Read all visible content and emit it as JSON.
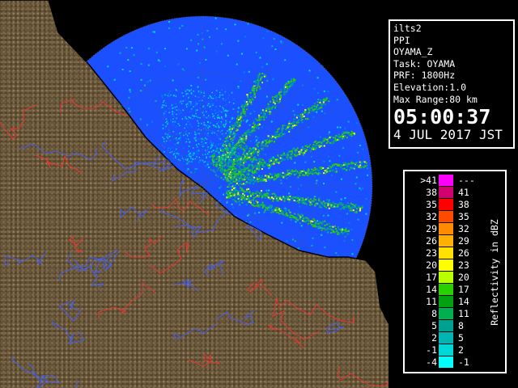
{
  "info": {
    "lines": [
      "ilts2",
      "PPI",
      "OYAMA_Z",
      "Task: OYAMA",
      "PRF: 1800Hz",
      "Elevation:1.0",
      "Max Range:80 km"
    ],
    "time": "05:00:37",
    "date": "4 JUL 2017 JST"
  },
  "legend": {
    "title": "Reflectivity in dBZ",
    "rows": [
      {
        "lo": ">41",
        "hi": "---",
        "color": "#ff00ff"
      },
      {
        "lo": "38",
        "hi": "41",
        "color": "#d0006e"
      },
      {
        "lo": "35",
        "hi": "38",
        "color": "#ff0000"
      },
      {
        "lo": "32",
        "hi": "35",
        "color": "#ff4a00"
      },
      {
        "lo": "29",
        "hi": "32",
        "color": "#ff8c00"
      },
      {
        "lo": "26",
        "hi": "29",
        "color": "#ffb000"
      },
      {
        "lo": "23",
        "hi": "26",
        "color": "#ffe000"
      },
      {
        "lo": "20",
        "hi": "23",
        "color": "#ffff00"
      },
      {
        "lo": "17",
        "hi": "20",
        "color": "#b8ff00"
      },
      {
        "lo": "14",
        "hi": "17",
        "color": "#28d000"
      },
      {
        "lo": "11",
        "hi": "14",
        "color": "#00a010"
      },
      {
        "lo": "8",
        "hi": "11",
        "color": "#00b050"
      },
      {
        "lo": "5",
        "hi": "8",
        "color": "#00a090"
      },
      {
        "lo": "2",
        "hi": "5",
        "color": "#00b4b4"
      },
      {
        "lo": "-1",
        "hi": "2",
        "color": "#00d8d8"
      },
      {
        "lo": "-4",
        "hi": "-1",
        "color": "#00ffff"
      }
    ]
  },
  "colors": {
    "background": "#000000",
    "radar_base": "#1a50ff",
    "radar_weak": "#0080ff",
    "land": "#6e5a3a",
    "coastline": "#000000",
    "rivers": "#4060ff",
    "boundaries": "#ff3030",
    "range_rings": "#404040"
  },
  "radar_site": {
    "label": ""
  }
}
